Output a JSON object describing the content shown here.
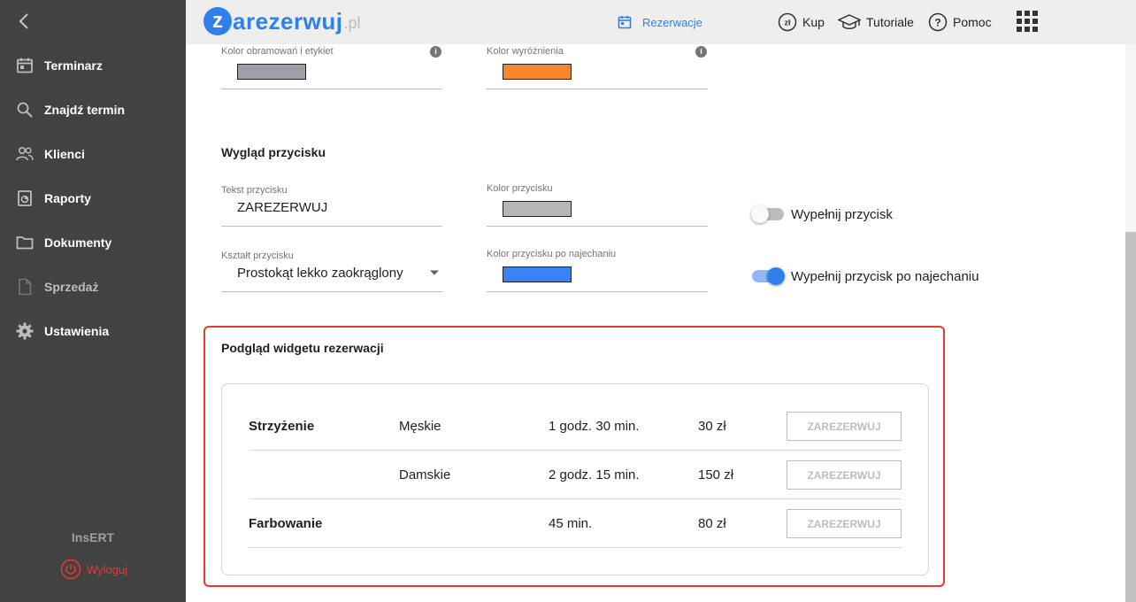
{
  "sidebar": {
    "items": [
      {
        "label": "Terminarz",
        "icon": "calendar-icon"
      },
      {
        "label": "Znajdź termin",
        "icon": "search-icon"
      },
      {
        "label": "Klienci",
        "icon": "people-icon"
      },
      {
        "label": "Raporty",
        "icon": "report-icon"
      },
      {
        "label": "Dokumenty",
        "icon": "folder-icon"
      },
      {
        "label": "Sprzedaż",
        "icon": "document-icon"
      },
      {
        "label": "Ustawienia",
        "icon": "gear-icon"
      }
    ],
    "brand": "InsERT",
    "logout": "Wyloguj"
  },
  "header": {
    "logo_z": "z",
    "logo_rest": "arezerwuj",
    "logo_pl": ".pl",
    "nav": {
      "reservations": "Rezerwacje",
      "buy": "Kup",
      "tutorials": "Tutoriale",
      "help": "Pomoc"
    }
  },
  "colors_section": {
    "border_label": "Kolor obramowań i etykiet",
    "border_color": "#9e9fa8",
    "highlight_label": "Kolor wyróżnienia",
    "highlight_color": "#f6862a"
  },
  "button_section": {
    "title": "Wygląd przycisku",
    "text_label": "Tekst przycisku",
    "text_value": "ZAREZERWUJ",
    "color_label": "Kolor przycisku",
    "color": "#b6b6b6",
    "shape_label": "Kształt przycisku",
    "shape_value": "Prostokąt lekko zaokrąglony",
    "hover_color_label": "Kolor przycisku po najechaniu",
    "hover_color": "#3b82f6",
    "fill_toggle_label": "Wypełnij przycisk",
    "fill_toggle_on": false,
    "fill_hover_toggle_label": "Wypełnij przycisk po najechaniu",
    "fill_hover_toggle_on": true
  },
  "preview": {
    "title": "Podgląd widgetu rezerwacji",
    "rows": [
      {
        "category": "Strzyżenie",
        "variant": "Męskie",
        "duration": "1 godz. 30 min.",
        "price": "30 zł",
        "button": "ZAREZERWUJ"
      },
      {
        "category": "",
        "variant": "Damskie",
        "duration": "2 godz. 15 min.",
        "price": "150 zł",
        "button": "ZAREZERWUJ"
      },
      {
        "category": "Farbowanie",
        "variant": "",
        "duration": "45 min.",
        "price": "80 zł",
        "button": "ZAREZERWUJ"
      }
    ]
  }
}
